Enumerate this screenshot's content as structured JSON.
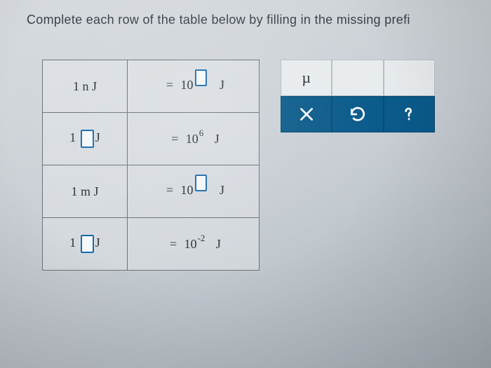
{
  "instruction": "Complete each row of the table below by filling in the missing prefi",
  "rows": [
    {
      "left_one": "1",
      "left_prefix": "n",
      "left_unit": "J",
      "equals": "=",
      "base": "10",
      "sup": "",
      "sup_input": true,
      "right_unit": "J",
      "prefix_input": false
    },
    {
      "left_one": "1",
      "left_prefix": "",
      "left_unit": "J",
      "equals": "=",
      "base": "10",
      "sup": "6",
      "sup_input": false,
      "right_unit": "J",
      "prefix_input": true
    },
    {
      "left_one": "1",
      "left_prefix": "m",
      "left_unit": "J",
      "equals": "=",
      "base": "10",
      "sup": "",
      "sup_input": true,
      "right_unit": "J",
      "prefix_input": false
    },
    {
      "left_one": "1",
      "left_prefix": "",
      "left_unit": "J",
      "equals": "=",
      "base": "10",
      "sup": "-2",
      "sup_input": false,
      "right_unit": "J",
      "prefix_input": true
    }
  ],
  "palette": {
    "mu": "µ",
    "blank1": "",
    "blank2": ""
  }
}
